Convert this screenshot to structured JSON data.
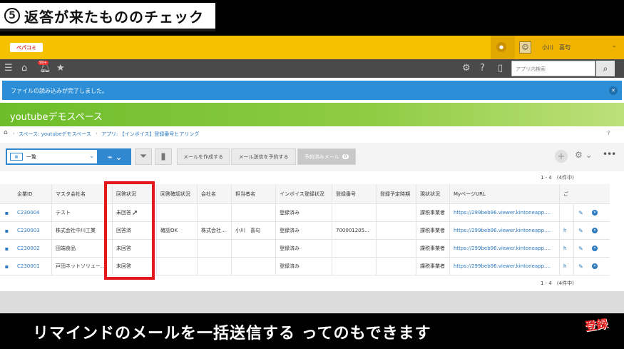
{
  "banner": {
    "number": "5",
    "title": "返答が来たもののチェック"
  },
  "header": {
    "logo": "ペパコミ",
    "user_name": "小川　喜句"
  },
  "nav": {
    "badge": "99+",
    "search_placeholder": "アプリ内検索"
  },
  "notification": {
    "message": "ファイルの読み込みが完了しました。"
  },
  "space": {
    "title": "youtubeデモスペース"
  },
  "breadcrumb": {
    "space": "スペース: youtubeデモスペース",
    "app": "アプリ: 【インボイス】登録番号ヒアリング"
  },
  "toolbar": {
    "view": "一覧",
    "create_mail": "メールを作成する",
    "schedule_mail": "メール送信を予約する",
    "scheduled_mail": "予約済みメール",
    "scheduled_count": "0"
  },
  "pager": {
    "top": "1 - 4　(4件中)",
    "bottom": "1 - 4　(4件中)"
  },
  "table": {
    "columns": [
      "企業ID",
      "マスタ会社名",
      "回答状況",
      "回答確認状況",
      "会社名",
      "担当者名",
      "インボイス登録状況",
      "登録番号",
      "登録予定時期",
      "現状状況",
      "MyページURL",
      "ご"
    ],
    "rows": [
      {
        "id": "C230004",
        "master": "テスト",
        "answer": "未回答",
        "confirm": "",
        "company": "",
        "person": "",
        "invoice": "登録済み",
        "reg_no": "",
        "plan": "",
        "status": "課税事業者",
        "url": "https://299beb96.viewer.kintoneapp....",
        "extra": ""
      },
      {
        "id": "C230003",
        "master": "株式会社中川工業",
        "answer": "回答済",
        "confirm": "確認OK",
        "company": "株式会社...",
        "person": "小川　喜句",
        "invoice": "登録済み",
        "reg_no": "700001205...",
        "plan": "",
        "status": "課税事業者",
        "url": "https://299beb96.viewer.kintoneapp....",
        "extra": "h"
      },
      {
        "id": "C230002",
        "master": "田端食品",
        "answer": "未回答",
        "confirm": "",
        "company": "",
        "person": "",
        "invoice": "登録済み",
        "reg_no": "",
        "plan": "",
        "status": "課税事業者",
        "url": "https://299beb96.viewer.kintoneapp....",
        "extra": "h"
      },
      {
        "id": "C230001",
        "master": "戸田ネットソリュー...",
        "answer": "未回答",
        "confirm": "",
        "company": "",
        "person": "",
        "invoice": "登録済み",
        "reg_no": "",
        "plan": "",
        "status": "課税事業者",
        "url": "https://299beb96.viewer.kintoneapp....",
        "extra": "h"
      }
    ]
  },
  "subtitle": "リマインドのメールを一括送信する ってのもできます",
  "stamp": "登録"
}
